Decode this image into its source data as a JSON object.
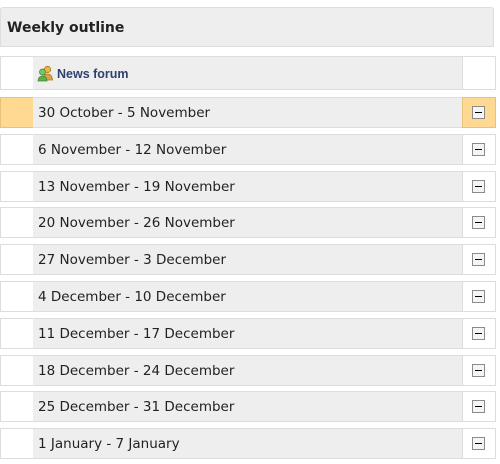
{
  "outline": {
    "title": "Weekly outline"
  },
  "news": {
    "label": "News forum",
    "icon": "forum-icon"
  },
  "toggle_icon": "minus-box-icon",
  "colors": {
    "current_week_highlight": "#ffd991",
    "row_background": "#eeeeee",
    "border": "#dddddd",
    "link": "#2f3f6e"
  },
  "weeks": [
    {
      "label": "30 October - 5 November",
      "current": true
    },
    {
      "label": "6 November - 12 November",
      "current": false
    },
    {
      "label": "13 November - 19 November",
      "current": false
    },
    {
      "label": "20 November - 26 November",
      "current": false
    },
    {
      "label": "27 November - 3 December",
      "current": false
    },
    {
      "label": "4 December - 10 December",
      "current": false
    },
    {
      "label": "11 December - 17 December",
      "current": false
    },
    {
      "label": "18 December - 24 December",
      "current": false
    },
    {
      "label": "25 December - 31 December",
      "current": false
    },
    {
      "label": "1 January - 7 January",
      "current": false
    }
  ]
}
